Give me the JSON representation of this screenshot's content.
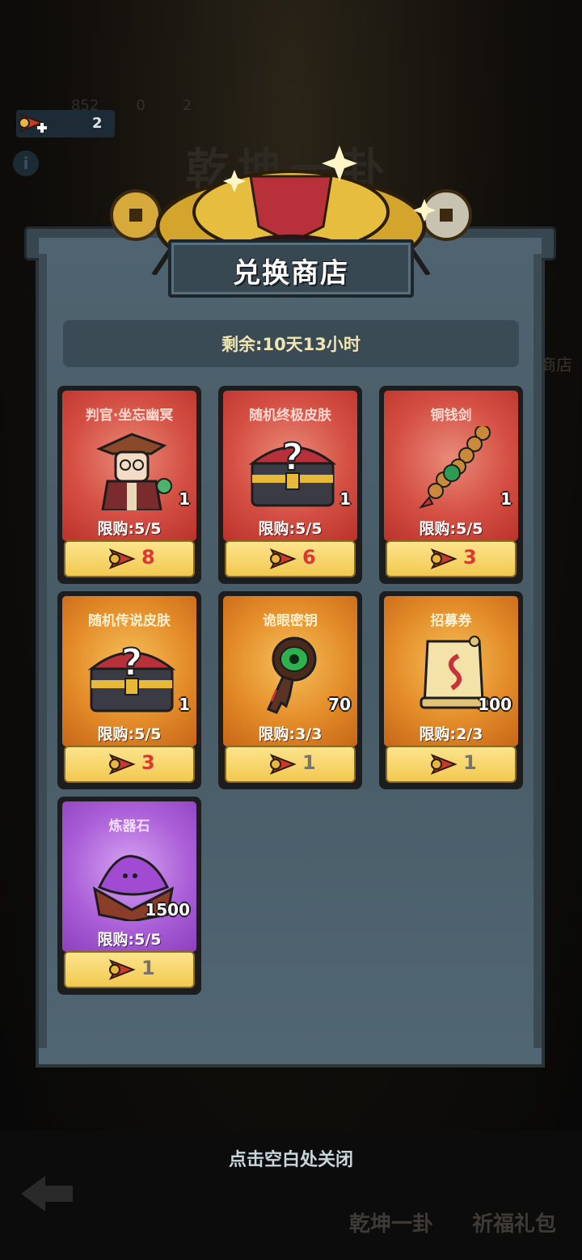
{
  "top_bar": {
    "ticket_count": "2"
  },
  "background": {
    "currency_values": [
      "852",
      "0",
      "2"
    ],
    "title": "乾坤一卦",
    "right_label": "商店",
    "bottom_labels": [
      "乾坤一卦",
      "祈福礼包"
    ]
  },
  "shop": {
    "title": "兑换商店",
    "timer": "剩余:10天13小时",
    "items": [
      {
        "name": "判官·坐忘幽冥",
        "qty": "1",
        "limit": "限购:5/5",
        "price": "8",
        "rarity": "red",
        "icon": "judge-character-icon"
      },
      {
        "name": "随机终极皮肤",
        "qty": "1",
        "limit": "限购:5/5",
        "price": "6",
        "rarity": "red",
        "icon": "mystery-chest-icon"
      },
      {
        "name": "铜钱剑",
        "qty": "1",
        "limit": "限购:5/5",
        "price": "3",
        "rarity": "red",
        "icon": "coin-sword-icon"
      },
      {
        "name": "随机传说皮肤",
        "qty": "1",
        "limit": "限购:5/5",
        "price": "3",
        "rarity": "orange",
        "icon": "mystery-chest-icon"
      },
      {
        "name": "诡眼密钥",
        "qty": "70",
        "limit": "限购:3/3",
        "price": "1",
        "rarity": "orange",
        "icon": "eye-key-icon"
      },
      {
        "name": "招募券",
        "qty": "100",
        "limit": "限购:2/3",
        "price": "1",
        "rarity": "orange",
        "icon": "recruit-scroll-icon"
      },
      {
        "name": "炼器石",
        "qty": "1500",
        "limit": "限购:5/5",
        "price": "1",
        "rarity": "purple",
        "icon": "refine-stone-icon"
      }
    ]
  },
  "close_hint": "点击空白处关闭",
  "colors": {
    "price_red": "#d83a32",
    "price_grey": "#7a7467",
    "panel": "#445661",
    "gold": "#f2c94f"
  }
}
